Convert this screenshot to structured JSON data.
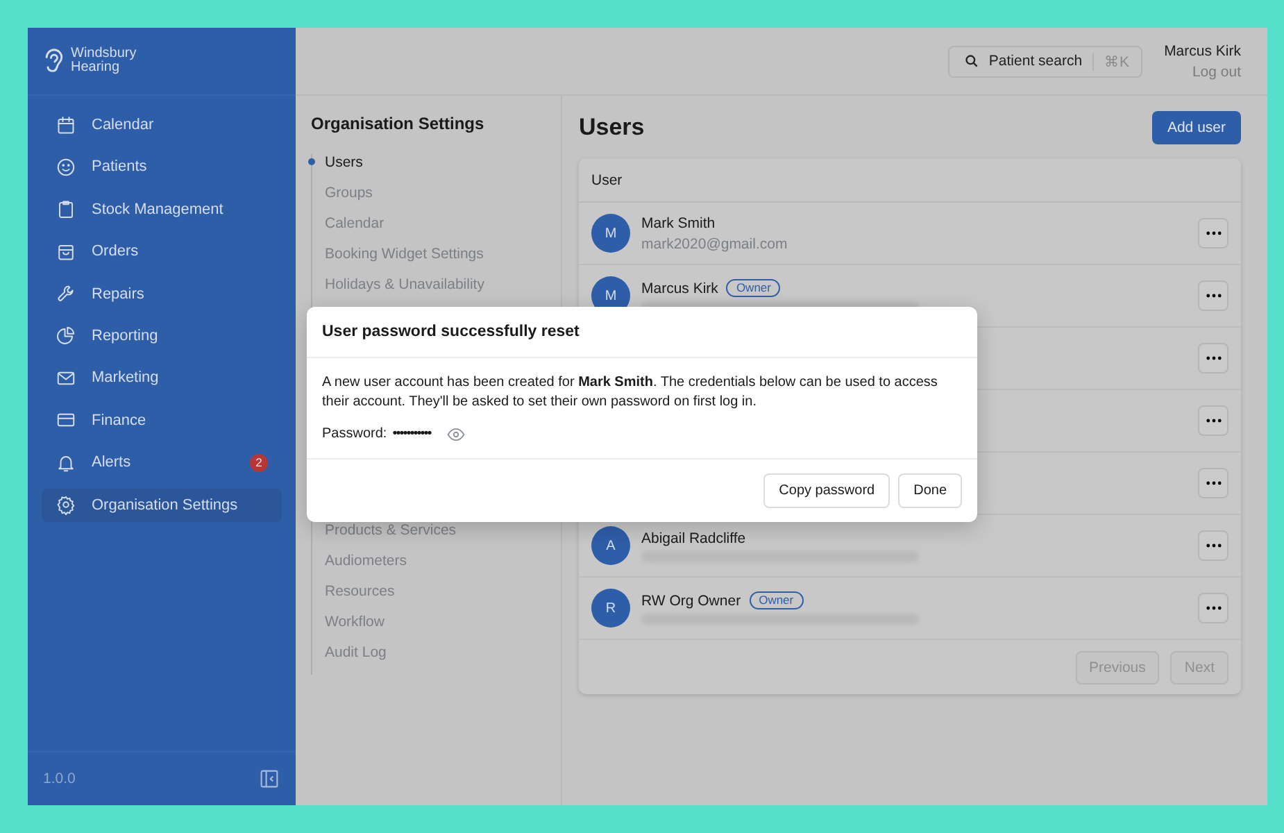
{
  "sidebar": {
    "brand_lines": [
      "Windsbury",
      "Hearing"
    ],
    "items": [
      {
        "kind": "calendar",
        "label": "Calendar",
        "selected": false
      },
      {
        "kind": "smiley",
        "label": "Patients",
        "selected": false
      },
      {
        "kind": "clipboard",
        "label": "Stock Management",
        "selected": false
      },
      {
        "kind": "bag",
        "label": "Orders",
        "selected": false
      },
      {
        "kind": "wrench",
        "label": "Repairs",
        "selected": false
      },
      {
        "kind": "pie",
        "label": "Reporting",
        "selected": false
      },
      {
        "kind": "envelope",
        "label": "Marketing",
        "selected": false
      },
      {
        "kind": "card",
        "label": "Finance",
        "selected": false
      },
      {
        "kind": "bell",
        "label": "Alerts",
        "selected": false,
        "badge": "2"
      },
      {
        "kind": "gear",
        "label": "Organisation Settings",
        "selected": true
      }
    ],
    "version": "1.0.0"
  },
  "topbar": {
    "search": {
      "placeholder": "Patient search",
      "shortcut": "⌘K"
    },
    "user_name": "Marcus Kirk",
    "logout": "Log out"
  },
  "settings_nav": {
    "title": "Organisation Settings",
    "items": [
      {
        "label": "Users",
        "selected": true
      },
      {
        "label": "Groups",
        "selected": false
      },
      {
        "label": "Calendar",
        "selected": false
      },
      {
        "label": "Booking Widget Settings",
        "selected": false
      },
      {
        "label": "Holidays & Unavailability",
        "selected": false
      }
    ],
    "items_after_dialog": [
      {
        "label": "Products & Services",
        "selected": false
      },
      {
        "label": "Audiometers",
        "selected": false
      },
      {
        "label": "Resources",
        "selected": false
      },
      {
        "label": "Workflow",
        "selected": false
      },
      {
        "label": "Audit Log",
        "selected": false
      }
    ]
  },
  "users": {
    "title": "Users",
    "add_button": "Add user",
    "column": "User",
    "rows": [
      {
        "kind": "full",
        "initial": "M",
        "name": "Mark Smith",
        "email": "mark2020@gmail.com"
      },
      {
        "kind": "full",
        "initial": "M",
        "name": "Marcus Kirk",
        "badge": "Owner",
        "email_blurred": true
      },
      {
        "kind": "covered"
      },
      {
        "kind": "covered"
      },
      {
        "kind": "covered"
      },
      {
        "kind": "full",
        "initial": "A",
        "name": "Abigail Radcliffe",
        "email_blurred": true
      },
      {
        "kind": "full",
        "initial": "R",
        "name": "RW Org Owner",
        "badge": "Owner",
        "email_blurred": true
      }
    ],
    "previous": "Previous",
    "next": "Next"
  },
  "dialog": {
    "title": "User password successfully reset",
    "message": "A new user account has been created for **Mark Smith**. The credentials below can be used to access their account. They'll be asked to set their own password on first log in.",
    "password_label": "Password:",
    "password": "•••••••••••",
    "buttons": [
      "Copy password",
      "Done"
    ]
  }
}
